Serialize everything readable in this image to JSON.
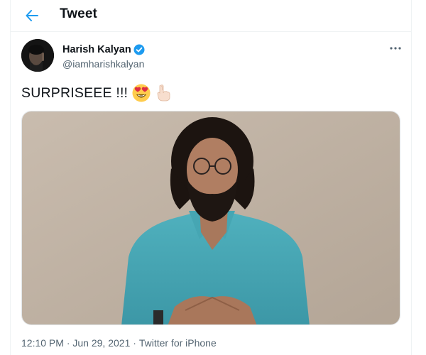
{
  "header": {
    "title": "Tweet",
    "back_icon": "arrow-left-icon",
    "accent_color": "#1d9bf0"
  },
  "author": {
    "display_name": "Harish Kalyan",
    "handle": "@iamharishkalyan",
    "verified": true,
    "verified_color": "#1d9bf0"
  },
  "tweet": {
    "text": "SURPRISEEE !!!",
    "emojis": [
      "heart-eyes-emoji",
      "pointing-down-emoji"
    ],
    "media": {
      "type": "video",
      "description_icon": "video-thumbnail"
    }
  },
  "meta": {
    "time": "12:10 PM",
    "separator": " · ",
    "date": "Jun 29, 2021",
    "source": "Twitter for iPhone"
  },
  "more_icon": "more-horizontal-icon"
}
